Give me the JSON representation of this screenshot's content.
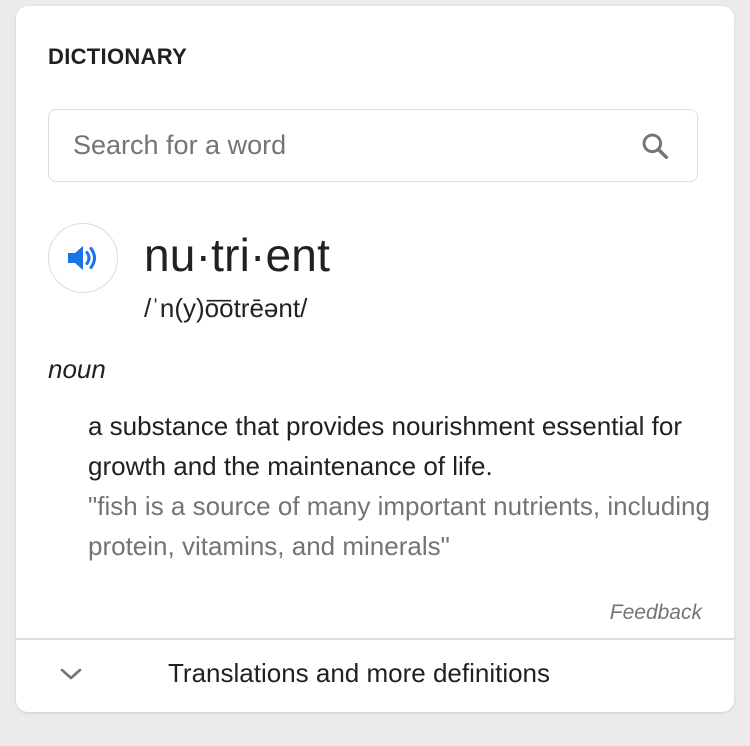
{
  "dictionary": {
    "heading": "DICTIONARY",
    "search": {
      "placeholder": "Search for a word",
      "value": "",
      "icon": "search-icon"
    },
    "entry": {
      "speaker_icon": "speaker-icon",
      "word": "nu·tri·ent",
      "phonetic": "/ˈn(y)o͞otrēənt/",
      "part_of_speech": "noun",
      "definition": "a substance that provides nourishment essential for growth and the maintenance of life.",
      "example": "\"fish is a source of many important nutrients, including protein, vitamins, and minerals\""
    },
    "feedback_label": "Feedback",
    "more": {
      "label": "Translations and more definitions",
      "icon": "chevron-down-icon"
    },
    "colors": {
      "accent": "#1a73e8",
      "text": "#202124",
      "secondary_text": "#70757a",
      "border": "#dadce0"
    }
  }
}
